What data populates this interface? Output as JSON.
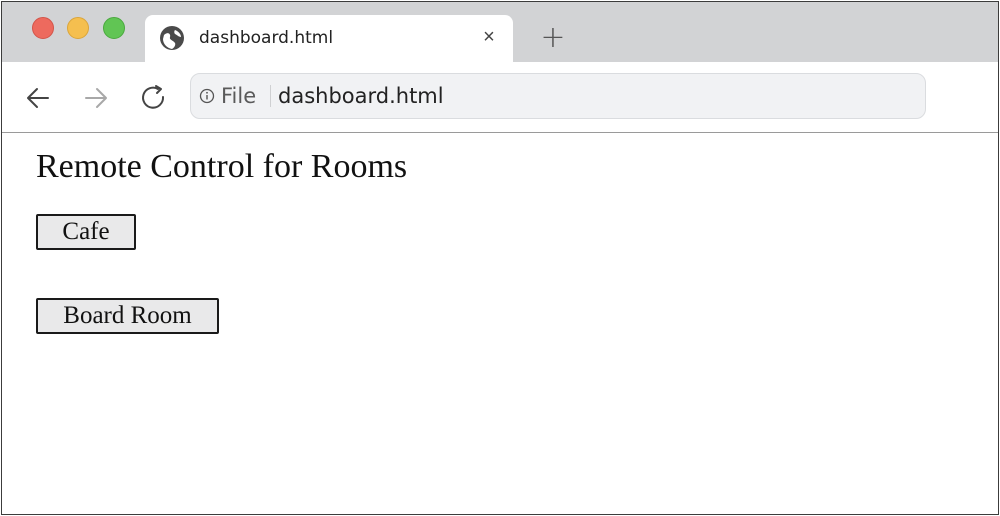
{
  "browser": {
    "tab": {
      "title": "dashboard.html",
      "close_glyph": "×",
      "favicon": "globe-icon"
    },
    "new_tab_glyph": "+",
    "omnibox": {
      "scheme_label": "File",
      "url": "dashboard.html"
    }
  },
  "page": {
    "title": "Remote Control for Rooms",
    "rooms": [
      {
        "label": "Cafe"
      },
      {
        "label": "Board Room"
      }
    ]
  }
}
